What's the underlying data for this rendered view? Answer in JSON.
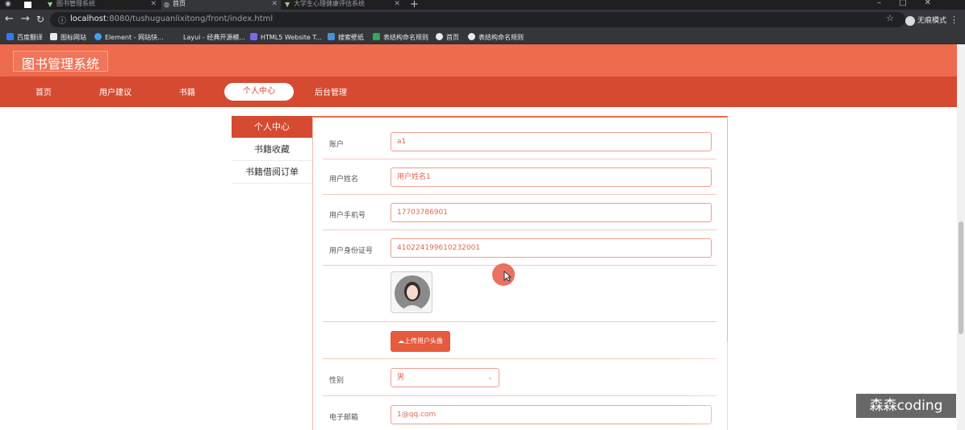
{
  "browser": {
    "tabs": [
      {
        "title": "图书管理系统",
        "active": false
      },
      {
        "title": "首页",
        "active": true
      },
      {
        "title": "大学生心理健康评估系统",
        "active": false
      }
    ],
    "url_host": "localhost",
    "url_rest": ":8080/tushuguanlixitong/front/index.html",
    "profile_label": "无痕模式",
    "bookmarks": [
      "百度翻译",
      "图标网站",
      "Element - 网站快...",
      "Layui - 经典开源模...",
      "HTML5 Website T...",
      "搜索壁纸",
      "表结构命名规则",
      "首页",
      "表结构命名规则"
    ]
  },
  "site": {
    "title": "图书管理系统",
    "nav": [
      "首页",
      "用户建议",
      "书籍",
      "个人中心",
      "后台管理"
    ],
    "active_nav": "个人中心"
  },
  "side_menu": [
    "个人中心",
    "书籍收藏",
    "书籍借阅订单"
  ],
  "form": {
    "account_label": "账户",
    "account_value": "a1",
    "name_label": "用户姓名",
    "name_value": "用户姓名1",
    "phone_label": "用户手机号",
    "phone_value": "17703786901",
    "idcard_label": "用户身份证号",
    "idcard_value": "410224199610232001",
    "upload_label": "上传用户头像",
    "gender_label": "性别",
    "gender_value": "男",
    "email_label": "电子邮箱",
    "email_value": "1@qq.com"
  },
  "watermark": "森森coding",
  "colors": {
    "header": "#ee6b4d",
    "navbar": "#d64a31",
    "accent": "#e65a3d"
  }
}
